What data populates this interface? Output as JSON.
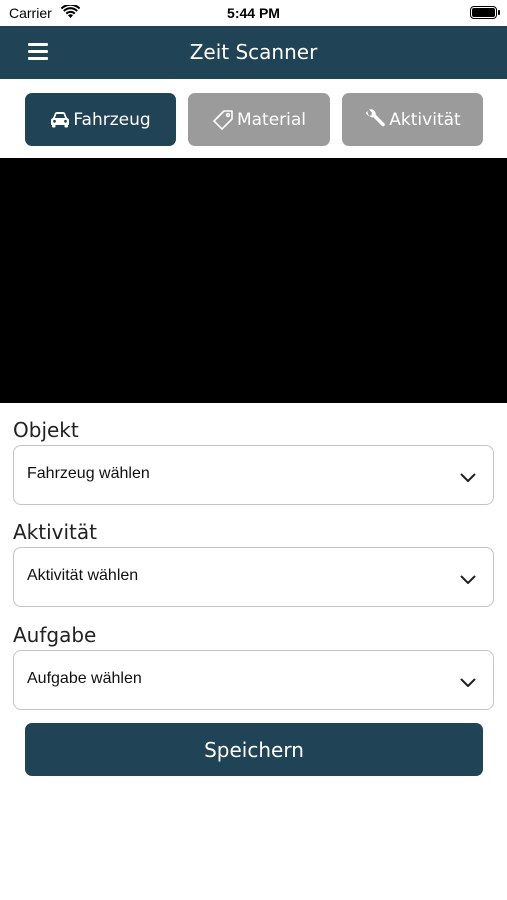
{
  "status": {
    "carrier": "Carrier",
    "time": "5:44 PM"
  },
  "app": {
    "title": "Zeit Scanner"
  },
  "tabs": [
    {
      "label": "Fahrzeug",
      "icon": "car-icon",
      "active": true
    },
    {
      "label": "Material",
      "icon": "tag-icon",
      "active": false
    },
    {
      "label": "Aktivität",
      "icon": "wrench-icon",
      "active": false
    }
  ],
  "form": {
    "object_label": "Objekt",
    "object_value": "Fahrzeug wählen",
    "activity_label": "Aktivität",
    "activity_value": "Aktivität wählen",
    "task_label": "Aufgabe",
    "task_value": "Aufgabe wählen"
  },
  "save_label": "Speichern",
  "colors": {
    "primary": "#214356",
    "inactive": "#9b9b9b",
    "border": "#c4c4c4"
  }
}
